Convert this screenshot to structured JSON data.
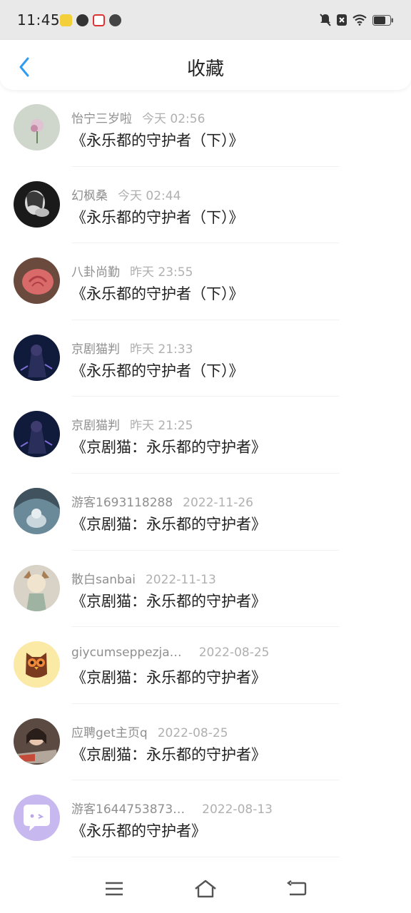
{
  "status_bar": {
    "time": "11:45",
    "left_icons": [
      "app-icon-yellow",
      "timer-icon",
      "news-icon",
      "cat-icon"
    ],
    "right_icons": [
      "mute-icon",
      "close-box-icon",
      "wifi-icon",
      "battery-icon"
    ]
  },
  "header": {
    "title": "收藏",
    "back_icon": "chevron-left-icon",
    "accent": "#2e9cf0"
  },
  "favorites": [
    {
      "user": "怡宁三岁啦",
      "time": "今天 02:56",
      "title": "《永乐都的守护者（下）》",
      "avatar": "avatar-flower-plain"
    },
    {
      "user": "幻枫桑",
      "time": "今天 02:44",
      "title": "《永乐都的守护者（下）》",
      "avatar": "avatar-bw-portrait"
    },
    {
      "user": "八卦尚勤",
      "time": "昨天 23:55",
      "title": "《永乐都的守护者（下）》",
      "avatar": "avatar-rose"
    },
    {
      "user": "京剧猫判",
      "time": "昨天 21:33",
      "title": "《永乐都的守护者（下）》",
      "avatar": "avatar-dark-character"
    },
    {
      "user": "京剧猫判",
      "time": "昨天 21:25",
      "title": "《京剧猫：永乐都的守护者》",
      "avatar": "avatar-dark-character"
    },
    {
      "user": "游客1693118288",
      "time": "2022-11-26",
      "title": "《京剧猫：永乐都的守护者》",
      "avatar": "avatar-cave-cat"
    },
    {
      "user": "散白sanbai",
      "time": "2022-11-13",
      "title": "《京剧猫：永乐都的守护者》",
      "avatar": "avatar-anime-cat"
    },
    {
      "user": "giycumseppezja…",
      "time": "2022-08-25",
      "title": "《京剧猫：永乐都的守护者》",
      "avatar": "avatar-owl"
    },
    {
      "user": "应聘get主页q",
      "time": "2022-08-25",
      "title": "《京剧猫：永乐都的守护者》",
      "avatar": "avatar-girl-photo"
    },
    {
      "user": "游客1644753873…",
      "time": "2022-08-13",
      "title": "《永乐都的守护者》",
      "avatar": "avatar-chat-bubble"
    }
  ],
  "navbar": {
    "menu_icon": "menu-icon",
    "home_icon": "home-icon",
    "back_icon": "back-icon"
  }
}
